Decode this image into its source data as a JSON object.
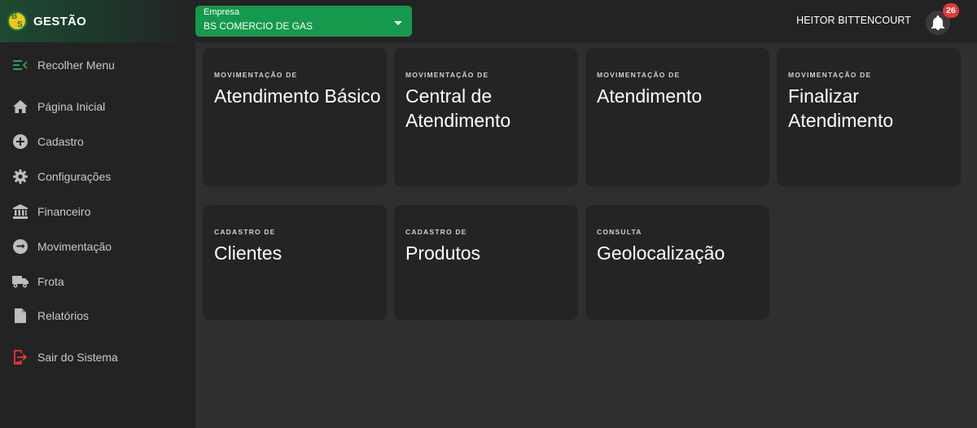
{
  "brand": {
    "title": "GESTÃO",
    "logo_letters": [
      "B",
      "S"
    ]
  },
  "empresa": {
    "label": "Empresa",
    "value": "BS COMERCIO DE GAS"
  },
  "user": {
    "name": "HEITOR BITTENCOURT",
    "notifications": "26"
  },
  "sidebar": {
    "items": [
      {
        "label": "Recolher Menu",
        "icon": "collapse-menu-icon"
      },
      {
        "label": "Página Inicial",
        "icon": "home-icon"
      },
      {
        "label": "Cadastro",
        "icon": "add-circle-icon"
      },
      {
        "label": "Configurações",
        "icon": "gear-icon"
      },
      {
        "label": "Financeiro",
        "icon": "bank-icon"
      },
      {
        "label": "Movimentação",
        "icon": "swap-circle-icon"
      },
      {
        "label": "Frota",
        "icon": "truck-icon"
      },
      {
        "label": "Relatórios",
        "icon": "document-icon"
      },
      {
        "label": "Sair do Sistema",
        "icon": "logout-icon"
      }
    ]
  },
  "cards": [
    {
      "eyebrow": "MOVIMENTAÇÃO DE",
      "title": "Atendimento Básico"
    },
    {
      "eyebrow": "MOVIMENTAÇÃO DE",
      "title": "Central de Atendimento"
    },
    {
      "eyebrow": "MOVIMENTAÇÃO DE",
      "title": "Atendimento"
    },
    {
      "eyebrow": "MOVIMENTAÇÃO DE",
      "title": "Finalizar Atendimento"
    },
    {
      "eyebrow": "CADASTRO DE",
      "title": "Clientes"
    },
    {
      "eyebrow": "CADASTRO DE",
      "title": "Produtos"
    },
    {
      "eyebrow": "CONSULTA",
      "title": "Geolocalização"
    }
  ],
  "colors": {
    "accent_green": "#15994c",
    "logout_red": "#e53935",
    "badge_red": "#e53935"
  }
}
